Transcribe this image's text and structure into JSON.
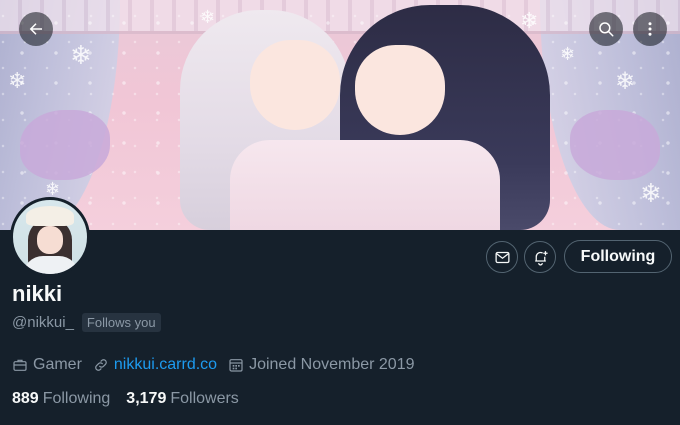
{
  "header": {
    "back_icon": "arrow-left-icon",
    "search_icon": "search-icon",
    "more_icon": "more-vertical-icon"
  },
  "profile": {
    "display_name": "nikki",
    "handle": "@nikkui_",
    "follows_you_label": "Follows you",
    "category": "Gamer",
    "link": "nikkui.carrd.co",
    "joined": "Joined November 2019",
    "following_count": "889",
    "following_label": "Following",
    "followers_count": "3,179",
    "followers_label": "Followers"
  },
  "actions": {
    "message_icon": "mail-icon",
    "notify_icon": "bell-plus-icon",
    "following_button_label": "Following"
  },
  "colors": {
    "background": "#15202b",
    "text_primary": "#f7f9f9",
    "text_secondary": "#8b98a5",
    "link": "#1d9bf0",
    "border": "#536471"
  }
}
